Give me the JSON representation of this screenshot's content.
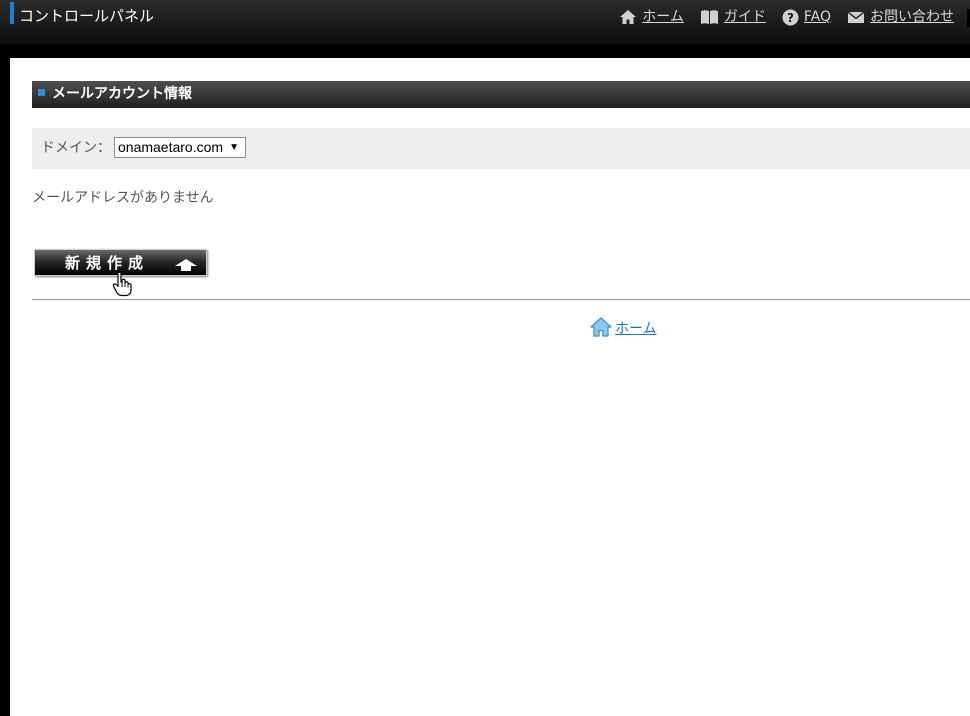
{
  "header": {
    "panel_title": "コントロールパネル",
    "nav": [
      {
        "icon": "home-icon",
        "label": "ホーム"
      },
      {
        "icon": "book-icon",
        "label": "ガイド"
      },
      {
        "icon": "help-icon",
        "label": "FAQ"
      },
      {
        "icon": "mail-icon",
        "label": "お問い合わせ"
      }
    ]
  },
  "section": {
    "title": "メールアカウント情報"
  },
  "domain": {
    "label": "ドメイン：",
    "selected": "onamaetaro.com"
  },
  "messages": {
    "empty": "メールアドレスがありません"
  },
  "buttons": {
    "new": "新規作成"
  },
  "footer": {
    "home_label": "ホーム"
  },
  "colors": {
    "accent": "#1a7fd4",
    "link": "#1a73c9",
    "header_bg": "#1a1a1a"
  }
}
